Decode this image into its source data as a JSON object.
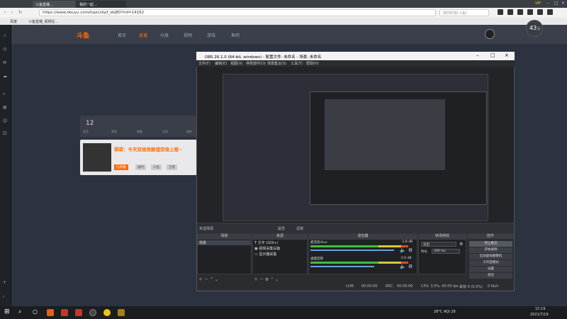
{
  "browser": {
    "tab_label": "斗鱼直播…",
    "tab2_label": "我的一起…",
    "url": "https://www.douyu.com/topic/dyjf_sbj8D?rid=14162",
    "search_placeholder": "搜你所想(斗鱼)",
    "bookmarks": [
      "百度",
      "斗鱼直播_视频在..."
    ],
    "vip_label": "VIP"
  },
  "site": {
    "logo": "斗鱼",
    "nav": [
      "首页",
      "直播",
      "分类",
      "视频",
      "游戏",
      "鱼吧"
    ],
    "active_nav": "直播",
    "tools_count": "12",
    "tools_labels": [
      "关注",
      "签到",
      "装备",
      "任务",
      "福利"
    ],
    "stream_title": "菲菲：今天双倍贡献值双倍上限~",
    "tags": [
      "已开播",
      "福利",
      "斗鱼",
      "王者"
    ],
    "viewer_badge": "43",
    "viewer_unit": "万"
  },
  "obs": {
    "title": "OBS 26.1.0 (64-bit, windows) - 配置文件: 未命名 - 场景: 未命名",
    "menu": [
      "文件(F)",
      "编辑(E)",
      "视图(V)",
      "停靠部件(D)",
      "场景集合(S)",
      "工具(T)",
      "帮助(H)"
    ],
    "no_source": "未选择源",
    "props": "属性",
    "filters": "滤镜",
    "docks": {
      "scenes": "场景",
      "sources": "来源",
      "mixer": "混音器",
      "transitions": "转场特效",
      "controls": "控件"
    },
    "scene_item": "场景",
    "sources": [
      "文字 (GDI+)",
      "视频采集设备",
      "显示器采集"
    ],
    "mixer_tracks": [
      {
        "name": "桌面音频",
        "db": "0.0 dB"
      },
      {
        "name": "麦克风/Aux",
        "db": "-1.8 dB"
      }
    ],
    "transition_type": "淡出",
    "duration_label": "时长",
    "duration_value": "300 ms",
    "controls": [
      "停止推流",
      "开始录制",
      "启动虚拟摄像机",
      "工作室模式",
      "设置",
      "退出"
    ],
    "status": {
      "live": "LIVE:",
      "live_time": "00:00:00",
      "rec": "REC:",
      "rec_time": "00:00:00",
      "cpu": "CPU: 3.5%, 60.00 fps",
      "dropped": "丢帧 0 (0.0%)",
      "kbps": "0 kb/s"
    }
  },
  "taskbar": {
    "temp": "28°C AQI 28",
    "time": "15:19",
    "date": "2021/7/19"
  },
  "colors": {
    "accent": "#ff6a00",
    "obs_bg": "#33363c",
    "meter_green": "#3fbf3f",
    "meter_yellow": "#d6c83a",
    "meter_red": "#d64a3a"
  }
}
